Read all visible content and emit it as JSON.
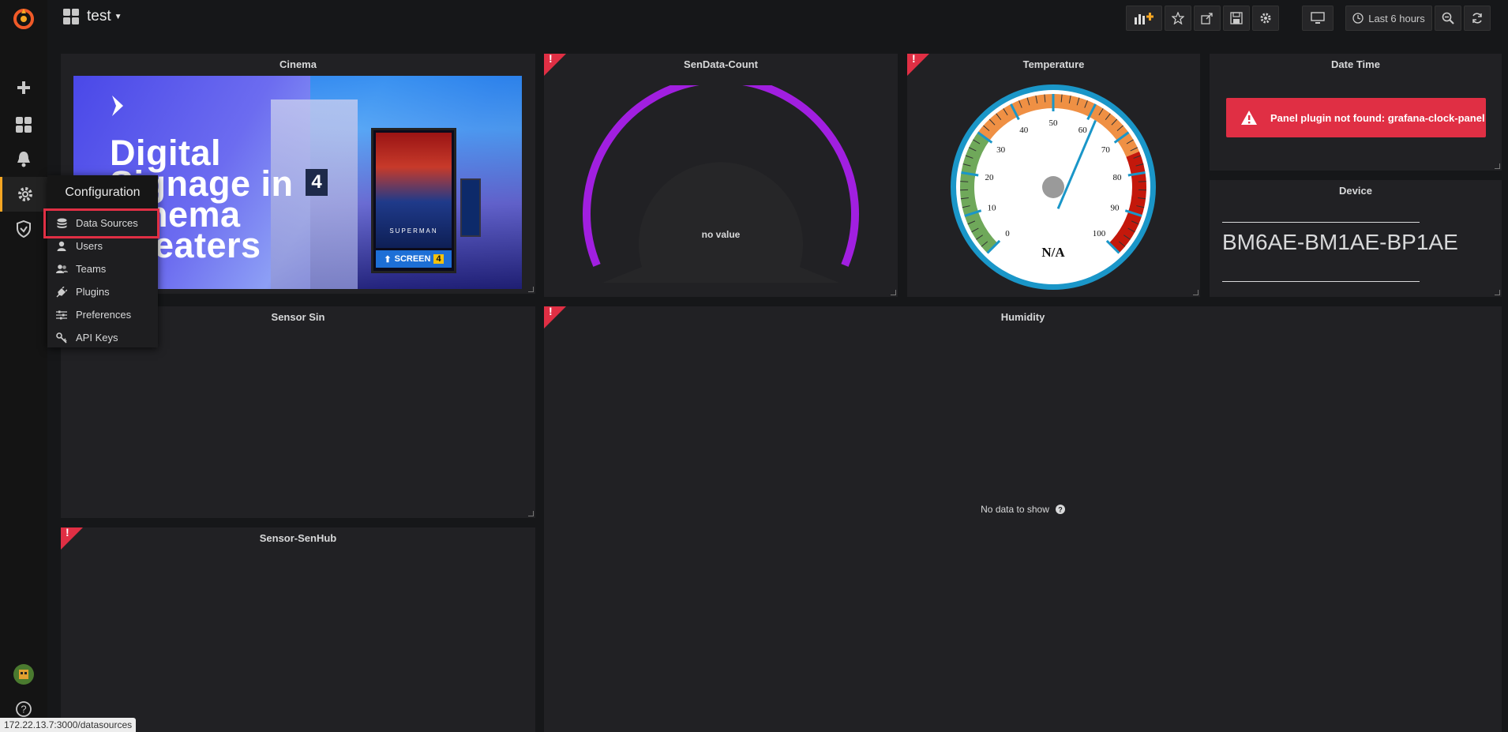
{
  "topbar": {
    "dashboard_title": "test",
    "time_range_label": "Last 6 hours"
  },
  "config_menu": {
    "title": "Configuration",
    "items": [
      {
        "label": "Data Sources",
        "icon": "database-icon"
      },
      {
        "label": "Users",
        "icon": "user-icon"
      },
      {
        "label": "Teams",
        "icon": "users-icon"
      },
      {
        "label": "Plugins",
        "icon": "plug-icon"
      },
      {
        "label": "Preferences",
        "icon": "sliders-icon"
      },
      {
        "label": "API Keys",
        "icon": "key-icon"
      }
    ]
  },
  "panels": {
    "cinema": {
      "title": "Cinema",
      "image_text_lines": [
        "Digital",
        "Signage in",
        "Cinema",
        "Theaters"
      ],
      "poster_title": "SUPERMAN",
      "poster_screen": "SCREEN",
      "screen_number": "4"
    },
    "sendata_count": {
      "title": "SenData-Count",
      "value_text": "no value"
    },
    "temperature": {
      "title": "Temperature",
      "reading": "N/A",
      "ticks": [
        "0",
        "10",
        "20",
        "30",
        "40",
        "50",
        "60",
        "70",
        "80",
        "90",
        "100"
      ],
      "needle_value": 62
    },
    "date_time": {
      "title": "Date Time",
      "error": "Panel plugin not found: grafana-clock-panel"
    },
    "device": {
      "title": "Device",
      "value": "BM6AE-BM1AE-BP1AE"
    },
    "sensor_sin": {
      "title": "Sensor Sin"
    },
    "humidity": {
      "title": "Humidity",
      "empty_text": "No data to show"
    },
    "sensor_senhub": {
      "title": "Sensor-SenHub"
    }
  },
  "statusbar": {
    "url": "172.22.13.7:3000/datasources"
  },
  "colors": {
    "accent": "#f5a623",
    "error": "#e02f44",
    "gauge_arc": "#a11fe0",
    "highlight_box": "#e02f44",
    "gauge_ring": "#1a96c8"
  }
}
